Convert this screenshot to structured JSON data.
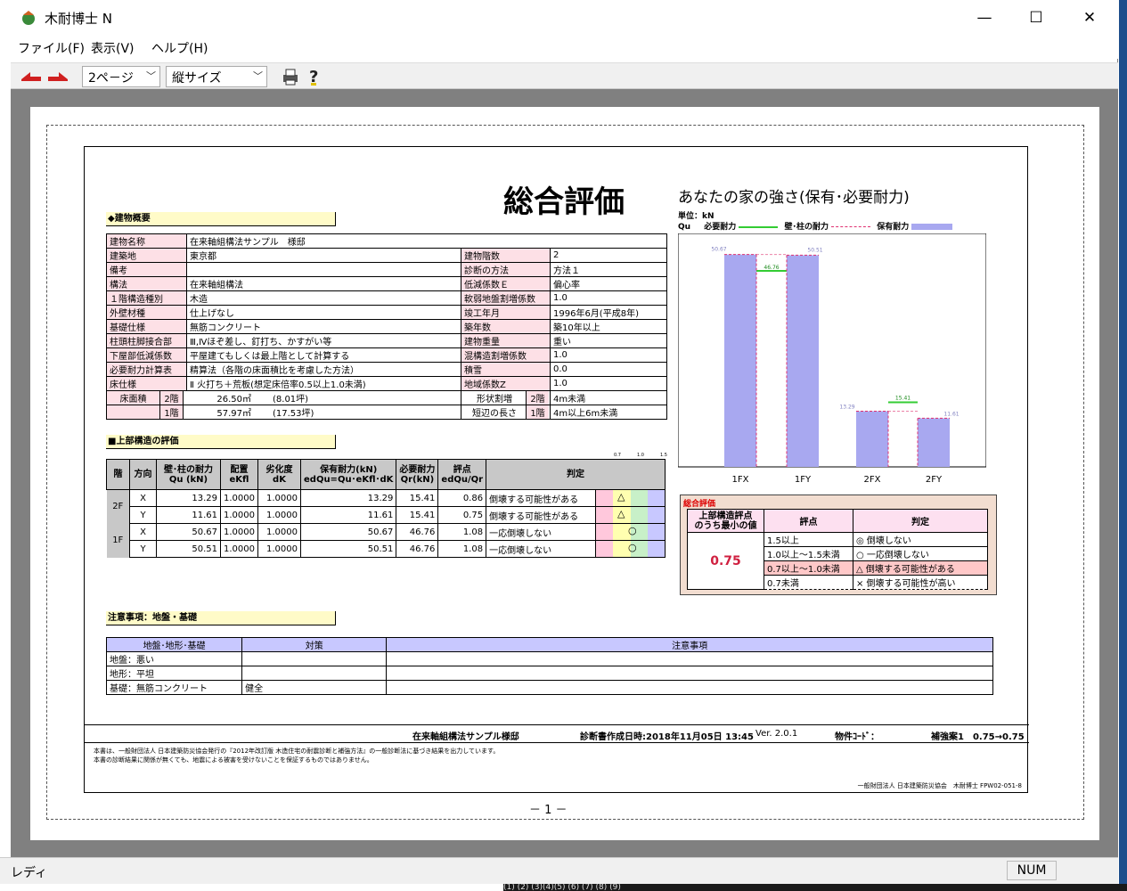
{
  "window": {
    "title": "木耐博士 N",
    "minimize": "—",
    "maximize": "☐",
    "close": "✕"
  },
  "menu": [
    "ファイル(F)",
    "表示(V)",
    "ヘルプ(H)"
  ],
  "toolbar": {
    "page_select": "2ペ－ジ",
    "size_select": "縦サイズ",
    "print_icon": "printer-icon",
    "help_icon": "help-icon"
  },
  "report": {
    "title": "総合評価",
    "building_header": "◆建物概要",
    "general": [
      [
        "建物名称",
        "在来軸組構法サンプル　様邸",
        "",
        ""
      ],
      [
        "建築地",
        "東京都",
        "建物階数",
        "2"
      ],
      [
        "備考",
        "",
        "診断の方法",
        "方法１"
      ],
      [
        "構法",
        "在来軸組構法",
        "低減係数Ｅ",
        "偏心率"
      ],
      [
        "１階構造種別",
        "木造",
        "軟弱地盤割増係数",
        "1.0"
      ],
      [
        "外壁材種",
        "仕上げなし",
        "竣工年月",
        "1996年6月(平成8年)"
      ],
      [
        "基礎仕様",
        "無筋コンクリート",
        "築年数",
        "築10年以上"
      ],
      [
        "柱頭柱脚接合部",
        "Ⅲ,Ⅳほぞ差し、釘打ち、かすがい等",
        "建物重量",
        "重い"
      ],
      [
        "下屋部低減係数",
        "平屋建てもしくは最上階として計算する",
        "混構造割増係数",
        "1.0"
      ],
      [
        "必要耐力計算表",
        "精算法（各階の床面積比を考慮した方法）",
        "積雪",
        "0.0"
      ],
      [
        "床仕様",
        "Ⅱ 火打ち＋荒板(想定床倍率0.5以上1.0未満)",
        "地域係数Z",
        "1.0"
      ]
    ],
    "floor_area": {
      "label": "床面積",
      "rows": [
        [
          "2階",
          "26.50㎡",
          "(8.01坪)"
        ],
        [
          "1階",
          "57.97㎡",
          "(17.53坪)"
        ]
      ]
    },
    "shape": {
      "label": "形状割増\n短辺の長さ",
      "rows": [
        [
          "2階",
          "4m未満"
        ],
        [
          "1階",
          "4m以上6m未満"
        ]
      ]
    },
    "upper_header": "■上部構造の評価",
    "upper_cols": [
      "階",
      "方向",
      "壁･柱の耐力\nQu (kN)",
      "配置\neKfl",
      "劣化度\ndK",
      "保有耐力(kN)\nedQu=Qu･eKfl･dK",
      "必要耐力\nQr(kN)",
      "評点\nedQu/Qr",
      "判定"
    ],
    "upper_rows": [
      [
        "2F",
        "X",
        "13.29",
        "1.0000",
        "1.0000",
        "13.29",
        "15.41",
        "0.86",
        "倒壊する可能性がある",
        "△"
      ],
      [
        "",
        "Y",
        "11.61",
        "1.0000",
        "1.0000",
        "11.61",
        "15.41",
        "0.75",
        "倒壊する可能性がある",
        "△"
      ],
      [
        "1F",
        "X",
        "50.67",
        "1.0000",
        "1.0000",
        "50.67",
        "46.76",
        "1.08",
        "一応倒壊しない",
        "○"
      ],
      [
        "",
        "Y",
        "50.51",
        "1.0000",
        "1.0000",
        "50.51",
        "46.76",
        "1.08",
        "一応倒壊しない",
        "○"
      ]
    ],
    "scale_marks": [
      "0.7",
      "1.0",
      "1.5"
    ],
    "notes_header": "注意事項：地盤・基礎",
    "notes_cols": [
      "地盤･地形･基礎",
      "対策",
      "注意事項"
    ],
    "notes_rows": [
      [
        "地盤：悪い",
        "",
        ""
      ],
      [
        "地形：平坦",
        "",
        ""
      ],
      [
        "基礎：無筋コンクリート",
        "健全",
        ""
      ]
    ],
    "chart_title": "あなたの家の強さ(保有･必要耐力)",
    "chart_unit": "単位：kN",
    "chart_legend": {
      "qu": "Qu",
      "need": "必要耐力",
      "wall": "壁･柱の耐力",
      "hold": "保有耐力"
    },
    "summary": {
      "header": "総合評価",
      "col1": "上部構造評点\nのうち最小の値",
      "col2": "評点",
      "col3": "判定",
      "min_value": "0.75",
      "rows": [
        [
          "1.5以上",
          "◎ 倒壊しない"
        ],
        [
          "1.0以上～1.5未満",
          "○ 一応倒壊しない"
        ],
        [
          "0.7以上～1.0未満",
          "△ 倒壊する可能性がある"
        ],
        [
          "0.7未満",
          "× 倒壊する可能性が高い"
        ]
      ]
    },
    "footer": {
      "building": "在来軸組構法サンプル様邸",
      "created": "診断書作成日時:2018年11月05日 13:45",
      "version": "Ver. 2.0.1",
      "code": "物件ｺｰﾄﾞ：",
      "plan": "補強案1　0.75→0.75",
      "disclaimer1": "本書は、一般財団法人 日本建築防災協会発行の『2012年改訂版 木造住宅の耐震診断と補強方法』の一般診断法に基づき結果を出力しています。",
      "disclaimer2": "本書の診断結果に関係が無くても、地震による被害を受けないことを保証するものではありません。",
      "org": "一般財団法人 日本建築防災協会　木耐博士 FPW02-051-8",
      "page": "－ 1 －"
    }
  },
  "chart_data": {
    "type": "bar",
    "categories": [
      "1FX",
      "1FY",
      "2FX",
      "2FY"
    ],
    "series": [
      {
        "name": "保有耐力",
        "values": [
          50.67,
          50.51,
          13.29,
          11.61
        ]
      },
      {
        "name": "必要耐力",
        "values": [
          46.76,
          46.76,
          15.41,
          15.41
        ]
      }
    ],
    "value_labels": [
      "50.67",
      "50.51",
      "46.76",
      "13.29",
      "11.61",
      "15.41"
    ],
    "colors": {
      "hold": "#a8a8f0",
      "need": "#33cc33",
      "wall": "#e03070"
    }
  },
  "status": {
    "text": "レディ",
    "num": "NUM"
  },
  "desktop_strip": "(1)   (2) (3)(4)(5)  (6)  (7)  (8)  (9)"
}
